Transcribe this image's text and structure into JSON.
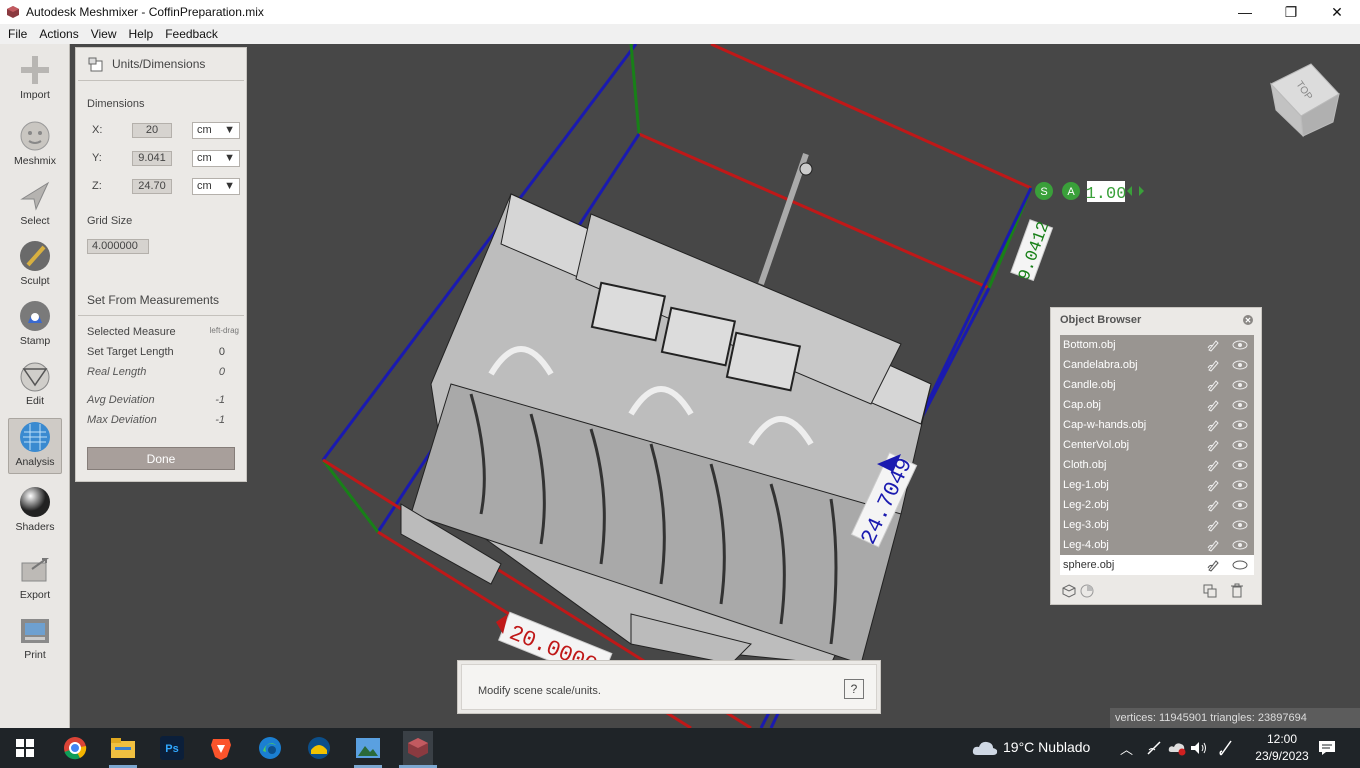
{
  "window": {
    "title": "Autodesk Meshmixer - CoffinPreparation.mix",
    "minimize": "—",
    "maximize": "❐",
    "close": "✕"
  },
  "menu": [
    "File",
    "Actions",
    "View",
    "Help",
    "Feedback"
  ],
  "tools": [
    {
      "label": "Import",
      "icon": "import-icon"
    },
    {
      "label": "Meshmix",
      "icon": "meshmix-icon"
    },
    {
      "label": "Select",
      "icon": "select-icon"
    },
    {
      "label": "Sculpt",
      "icon": "sculpt-icon"
    },
    {
      "label": "Stamp",
      "icon": "stamp-icon"
    },
    {
      "label": "Edit",
      "icon": "edit-icon"
    },
    {
      "label": "Analysis",
      "icon": "analysis-icon",
      "active": true
    },
    {
      "label": "Shaders",
      "icon": "shaders-icon"
    },
    {
      "label": "Export",
      "icon": "export-icon"
    },
    {
      "label": "Print",
      "icon": "print-icon"
    }
  ],
  "units_panel": {
    "title": "Units/Dimensions",
    "dimensions_label": "Dimensions",
    "x": {
      "axis": "X:",
      "value": "20",
      "unit": "cm"
    },
    "y": {
      "axis": "Y:",
      "value": "9.041",
      "unit": "cm"
    },
    "z": {
      "axis": "Z:",
      "value": "24.70",
      "unit": "cm"
    },
    "grid_size_label": "Grid Size",
    "grid_size_value": "4.000000",
    "set_from_measurements": "Set From Measurements",
    "selected_measure": {
      "label": "Selected Measure",
      "value": "left-drag"
    },
    "set_target_length": {
      "label": "Set Target Length",
      "value": "0"
    },
    "real_length": {
      "label": "Real Length",
      "value": "0"
    },
    "avg_deviation": {
      "label": "Avg Deviation",
      "value": "-1"
    },
    "max_deviation": {
      "label": "Max Deviation",
      "value": "-1"
    },
    "done": "Done"
  },
  "viewport": {
    "view_cube_label": "TOP",
    "scale_s": "S",
    "scale_a": "A",
    "scale_value": "1.00",
    "dim_z": "24.7049",
    "dim_x": "20.0000",
    "dim_y": "9.0412"
  },
  "object_browser": {
    "title": "Object Browser",
    "objects": [
      "Bottom.obj",
      "Candelabra.obj",
      "Candle.obj",
      "Cap.obj",
      "Cap-w-hands.obj",
      "CenterVol.obj",
      "Cloth.obj",
      "Leg-1.obj",
      "Leg-2.obj",
      "Leg-3.obj",
      "Leg-4.obj",
      "sphere.obj"
    ],
    "selected": "sphere.obj"
  },
  "help": {
    "message": "Modify scene scale/units.",
    "help_button": "?"
  },
  "stats": "vertices: 11945901 triangles: 23897694",
  "taskbar": {
    "weather": "19°C  Nublado",
    "time": "12:00",
    "date": "23/9/2023"
  },
  "colors": {
    "bbox_red": "#c01818",
    "bbox_blue": "#1a1ab0",
    "bbox_green": "#188018",
    "label_green": "#3aa03a"
  }
}
